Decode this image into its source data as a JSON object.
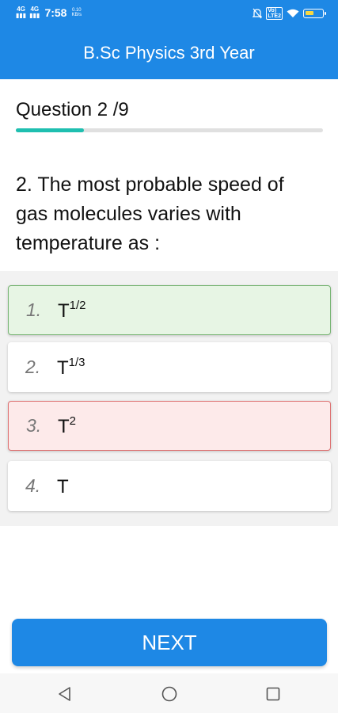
{
  "status_bar": {
    "signal1": "4G",
    "signal2": "4G",
    "time": "7:58",
    "speed_value": "0.10",
    "speed_unit": "KB/s",
    "volte_top": "Vo)",
    "volte_bottom": "LTE2"
  },
  "header": {
    "title": "B.Sc Physics 3rd Year"
  },
  "quiz": {
    "counter": "Question 2 /9",
    "progress_fraction": 0.222,
    "question": "2. The most probable speed of gas molecules varies with temperature as :"
  },
  "options": [
    {
      "number": "1.",
      "base": "T",
      "exponent": "1/2",
      "state": "correct"
    },
    {
      "number": "2.",
      "base": "T",
      "exponent": "1/3",
      "state": "neutral"
    },
    {
      "number": "3.",
      "base": "T",
      "exponent": "2",
      "state": "wrong"
    },
    {
      "number": "4.",
      "base": "T",
      "exponent": "",
      "state": "neutral"
    }
  ],
  "next_button": {
    "label": "NEXT"
  },
  "colors": {
    "primary": "#1e88e5",
    "progress": "#1fbfb0",
    "correct_bg": "#e7f5e4",
    "wrong_bg": "#fdeaea"
  },
  "icons": {
    "nav_back": "back-triangle-icon",
    "nav_home": "home-circle-icon",
    "nav_recent": "recent-square-icon"
  }
}
